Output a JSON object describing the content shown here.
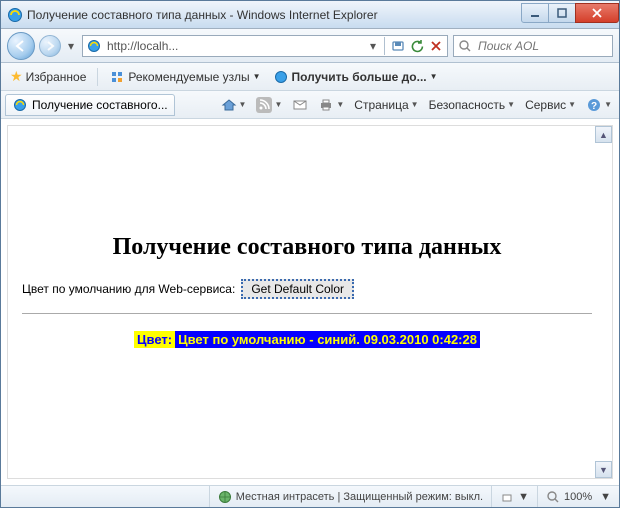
{
  "window": {
    "title": "Получение составного типа данных - Windows Internet Explorer"
  },
  "nav": {
    "url": "http://localh...",
    "search_placeholder": "Поиск AOL"
  },
  "favbar": {
    "favorites": "Избранное",
    "suggested": "Рекомендуемые узлы",
    "get_more": "Получить больше до..."
  },
  "tab": {
    "title": "Получение составного..."
  },
  "commands": {
    "page": "Страница",
    "safety": "Безопасность",
    "service": "Сервис"
  },
  "page": {
    "heading": "Получение составного типа данных",
    "label_default_color": "Цвет по умолчанию для Web-сервиса:",
    "button_get_default": "Get Default Color",
    "result_label": "Цвет:",
    "result_value": "Цвет по умолчанию - синий. 09.03.2010 0:42:28"
  },
  "status": {
    "zone": "Местная интрасеть | Защищенный режим: выкл.",
    "zoom": "100%"
  }
}
